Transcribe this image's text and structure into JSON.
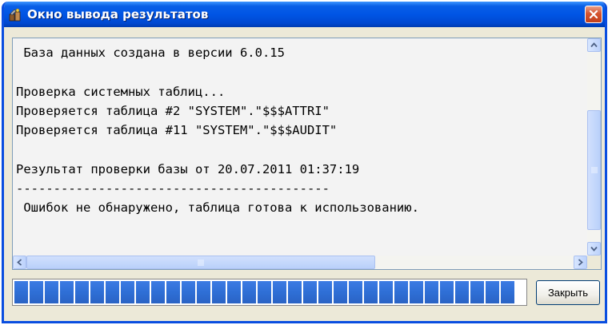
{
  "window": {
    "title": "Окно вывода результатов",
    "accent_color": "#0055e5",
    "close_color": "#d5542f"
  },
  "output": {
    "lines": [
      " База данных создана в версии 6.0.15",
      "",
      "Проверка системных таблиц...",
      "Проверяется таблица #2 \"SYSTEM\".\"$$$ATTRI\"",
      "Проверяется таблица #11 \"SYSTEM\".\"$$$AUDIT\"",
      "",
      "Результат проверки базы от 20.07.2011 01:37:19",
      "------------------------------------------",
      " Ошибок не обнаружено, таблица готова к использованию."
    ]
  },
  "progress": {
    "fraction": 1.0,
    "color": "#2f6fd6"
  },
  "buttons": {
    "close_label": "Закрыть"
  },
  "icons": {
    "app": "database-app-icon",
    "close": "close-icon",
    "scroll_up": "arrow-up-icon",
    "scroll_down": "arrow-down-icon",
    "scroll_left": "arrow-left-icon",
    "scroll_right": "arrow-right-icon"
  }
}
